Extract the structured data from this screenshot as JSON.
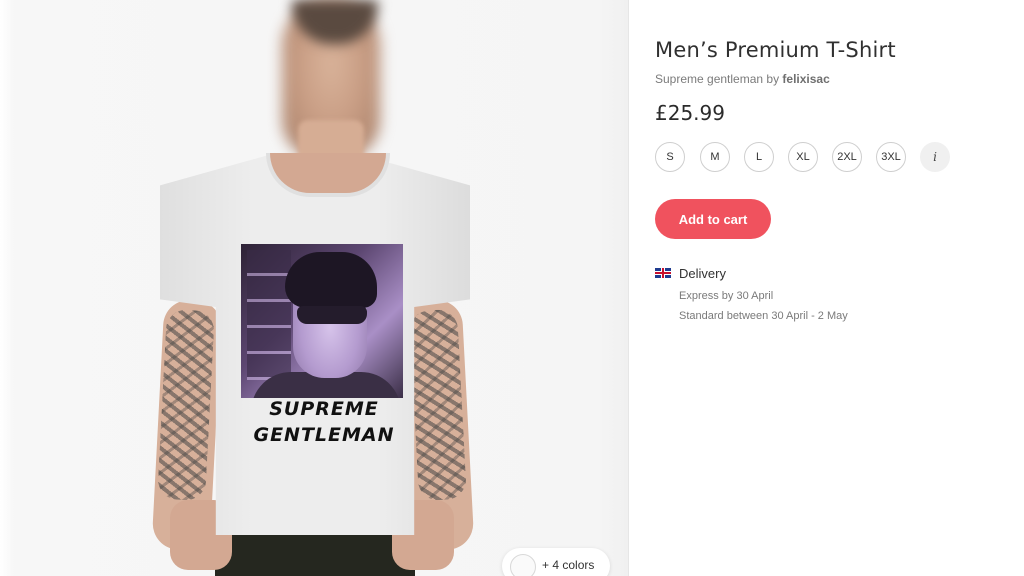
{
  "product": {
    "title": "Men’s Premium T-Shirt",
    "subtitle_prefix": "Supreme gentleman by ",
    "artist": "felixisac",
    "price": "£25.99",
    "sizes": [
      "S",
      "M",
      "L",
      "XL",
      "2XL",
      "3XL"
    ],
    "size_info_label": "i",
    "add_to_cart_label": "Add to cart"
  },
  "image": {
    "print_caption_line1": "SUPREME",
    "print_caption_line2": "GENTLEMAN",
    "colors_label": "+ 4 colors"
  },
  "delivery": {
    "title": "Delivery",
    "express": "Express by 30 April",
    "standard": "Standard between 30 April - 2 May",
    "flag_icon": "uk-flag-icon"
  },
  "colors": {
    "accent": "#f0525e"
  }
}
